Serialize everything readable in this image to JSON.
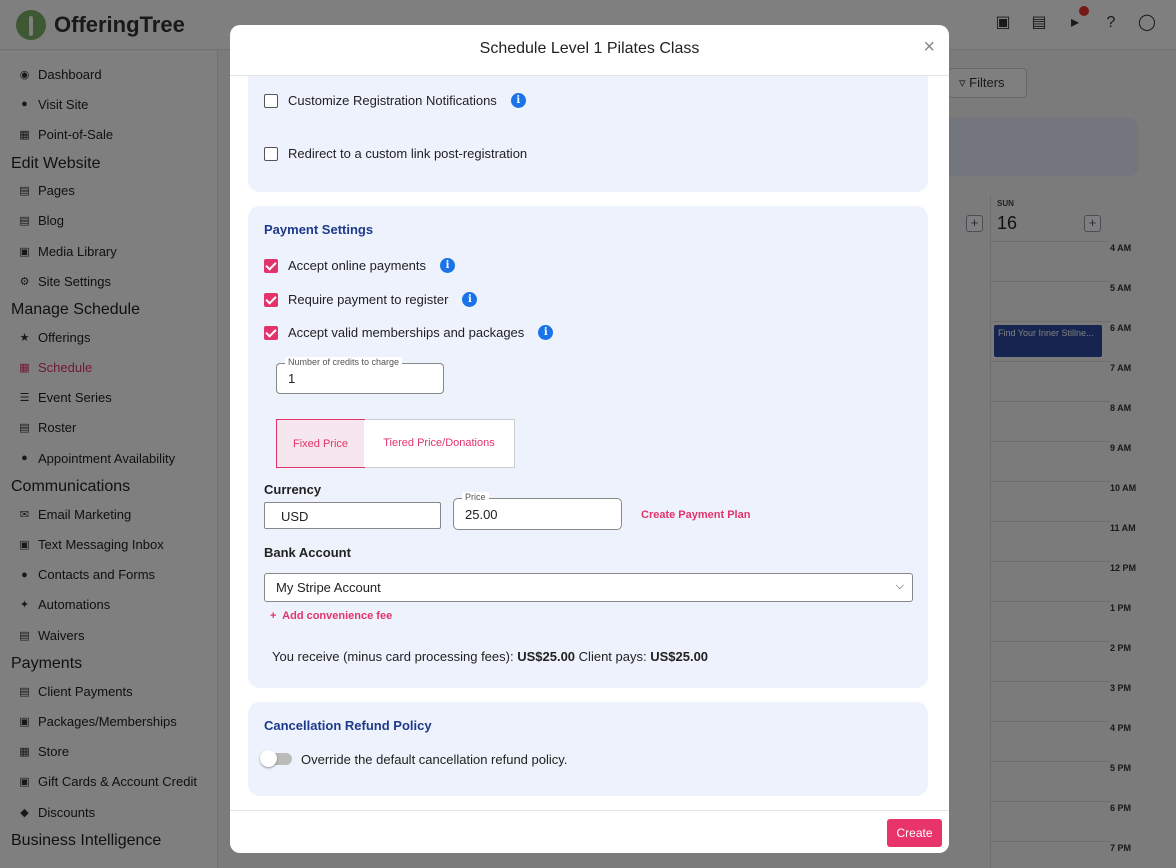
{
  "app": {
    "logo_text": "OfferingTree",
    "top_icons": [
      "chat-icon",
      "clipboard-icon",
      "megaphone-icon",
      "help-icon",
      "account-icon"
    ],
    "filters_label": "Filters"
  },
  "sidebar": {
    "items_top": [
      {
        "label": "Dashboard",
        "icon": "dashboard-icon"
      },
      {
        "label": "Visit Site",
        "icon": "globe-icon"
      },
      {
        "label": "Point-of-Sale",
        "icon": "register-icon"
      }
    ],
    "sections": [
      {
        "title": "Edit Website",
        "items": [
          "Pages",
          "Blog",
          "Media Library",
          "Site Settings"
        ]
      },
      {
        "title": "Manage Schedule",
        "items": [
          "Offerings",
          "Schedule",
          "Event Series",
          "Roster",
          "Appointment Availability"
        ]
      },
      {
        "title": "Communications",
        "items": [
          "Email Marketing",
          "Text Messaging Inbox",
          "Contacts and Forms",
          "Automations",
          "Waivers"
        ]
      },
      {
        "title": "Payments",
        "items": [
          "Client Payments",
          "Packages/Memberships",
          "Store",
          "Gift Cards & Account Credit",
          "Discounts"
        ]
      },
      {
        "title": "Business Intelligence",
        "items": []
      }
    ],
    "active": "Schedule"
  },
  "calendar": {
    "day_name": "SUN",
    "day_num": "16",
    "hours": [
      "4 AM",
      "5 AM",
      "6 AM",
      "7 AM",
      "8 AM",
      "9 AM",
      "10 AM",
      "11 AM",
      "12 PM",
      "1 PM",
      "2 PM",
      "3 PM",
      "4 PM",
      "5 PM",
      "6 PM",
      "7 PM"
    ],
    "event_title": "Find Your Inner Stillne..."
  },
  "modal": {
    "title": "Schedule Level 1 Pilates Class",
    "close": "×",
    "registration": {
      "customize_label": "Customize Registration Notifications",
      "customize_checked": false,
      "redirect_label": "Redirect to a custom link post-registration",
      "redirect_checked": false
    },
    "payment": {
      "section_title": "Payment Settings",
      "accept_online_label": "Accept online payments",
      "require_payment_label": "Require payment to register",
      "accept_memberships_label": "Accept valid memberships and packages",
      "credits_label": "Number of credits to charge",
      "credits_value": "1",
      "tabs": [
        "Fixed Price",
        "Tiered Price/Donations"
      ],
      "active_tab": "Fixed Price",
      "currency_heading": "Currency",
      "currency_value": "USD",
      "price_label": "Price",
      "price_value": "25.00",
      "payment_plan_link": "Create Payment Plan",
      "bank_heading": "Bank Account",
      "bank_value": "My Stripe Account",
      "convenience_fee_link": "Add convenience fee",
      "receive_label": "You receive (minus card processing fees):",
      "receive_value": "US$25.00",
      "client_pays_label": "Client pays:",
      "client_pays_value": "US$25.00"
    },
    "cancellation": {
      "section_title": "Cancellation Refund Policy",
      "override_label": "Override the default cancellation refund policy.",
      "override_on": false
    },
    "create_label": "Create"
  },
  "colors": {
    "accent": "#e2336b",
    "section_title": "#1d3a8a",
    "info": "#1a73e8",
    "card_bg": "#eef2fd"
  }
}
